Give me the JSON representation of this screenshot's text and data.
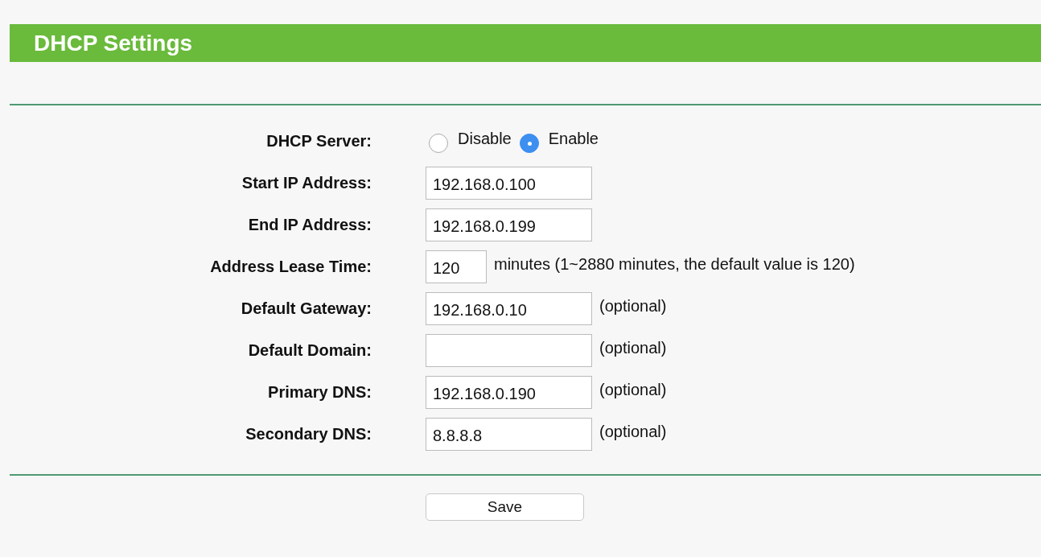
{
  "header": {
    "title": "DHCP Settings"
  },
  "fields": [
    {
      "kind": "radio",
      "label": "DHCP Server:",
      "options": [
        {
          "label": "Disable",
          "selected": false
        },
        {
          "label": "Enable",
          "selected": true
        }
      ]
    },
    {
      "kind": "text",
      "label": "Start IP Address:",
      "value": "192.168.0.100"
    },
    {
      "kind": "text",
      "label": "End IP Address:",
      "value": "192.168.0.199"
    },
    {
      "kind": "short",
      "label": "Address Lease Time:",
      "value": "120",
      "note": "minutes (1~2880 minutes, the default value is 120)"
    },
    {
      "kind": "text",
      "label": "Default Gateway:",
      "value": "192.168.0.10",
      "note": "(optional)"
    },
    {
      "kind": "text",
      "label": "Default Domain:",
      "note": "(optional)"
    },
    {
      "kind": "text",
      "label": "Primary DNS:",
      "value": "192.168.0.190",
      "note": "(optional)"
    },
    {
      "kind": "text",
      "label": "Secondary DNS:",
      "value": "8.8.8.8",
      "note": "(optional)"
    }
  ],
  "save_button": "Save"
}
